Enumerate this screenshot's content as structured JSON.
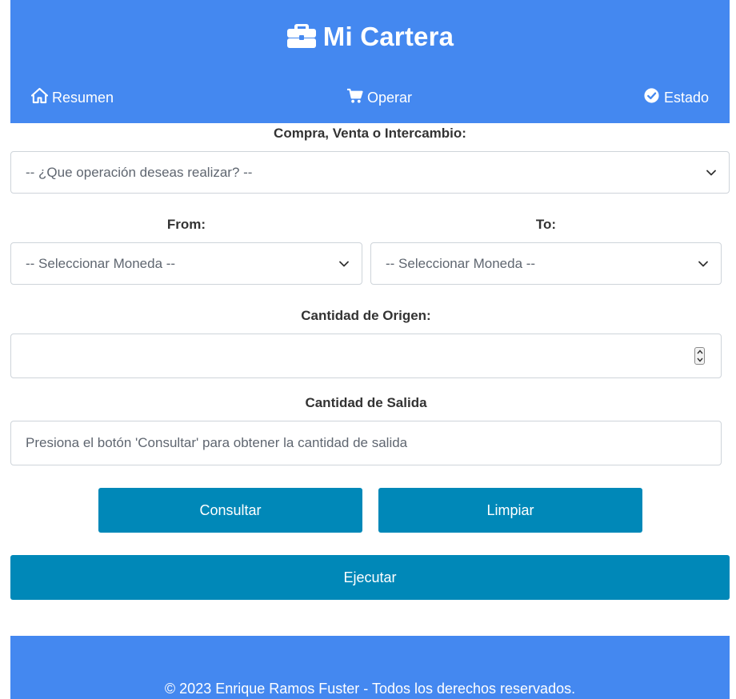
{
  "header": {
    "brand_icon": "briefcase-icon",
    "title": "Mi Cartera",
    "background": "#4488f0"
  },
  "nav": {
    "items": [
      {
        "label": "Resumen",
        "icon": "home-icon"
      },
      {
        "label": "Operar",
        "icon": "shopping-cart-icon"
      },
      {
        "label": "Estado",
        "icon": "check-circle-icon"
      }
    ]
  },
  "form": {
    "operation_label": "Compra, Venta o Intercambio:",
    "operation_select": "-- ¿Que operación deseas realizar? --",
    "from_label": "From:",
    "from_select": "-- Seleccionar Moneda --",
    "to_label": "To:",
    "to_select": "-- Seleccionar Moneda --",
    "amount_in_label": "Cantidad de Origen:",
    "amount_in_value": "",
    "amount_out_label": "Cantidad de Salida",
    "amount_out_placeholder": "Presiona el botón 'Consultar' para obtener la cantidad de salida",
    "consult_button": "Consultar",
    "clear_button": "Limpiar",
    "execute_button": "Ejecutar",
    "button_color": "#0088b8"
  },
  "footer": {
    "text": "© 2023 Enrique Ramos Fuster - Todos los derechos reservados."
  }
}
